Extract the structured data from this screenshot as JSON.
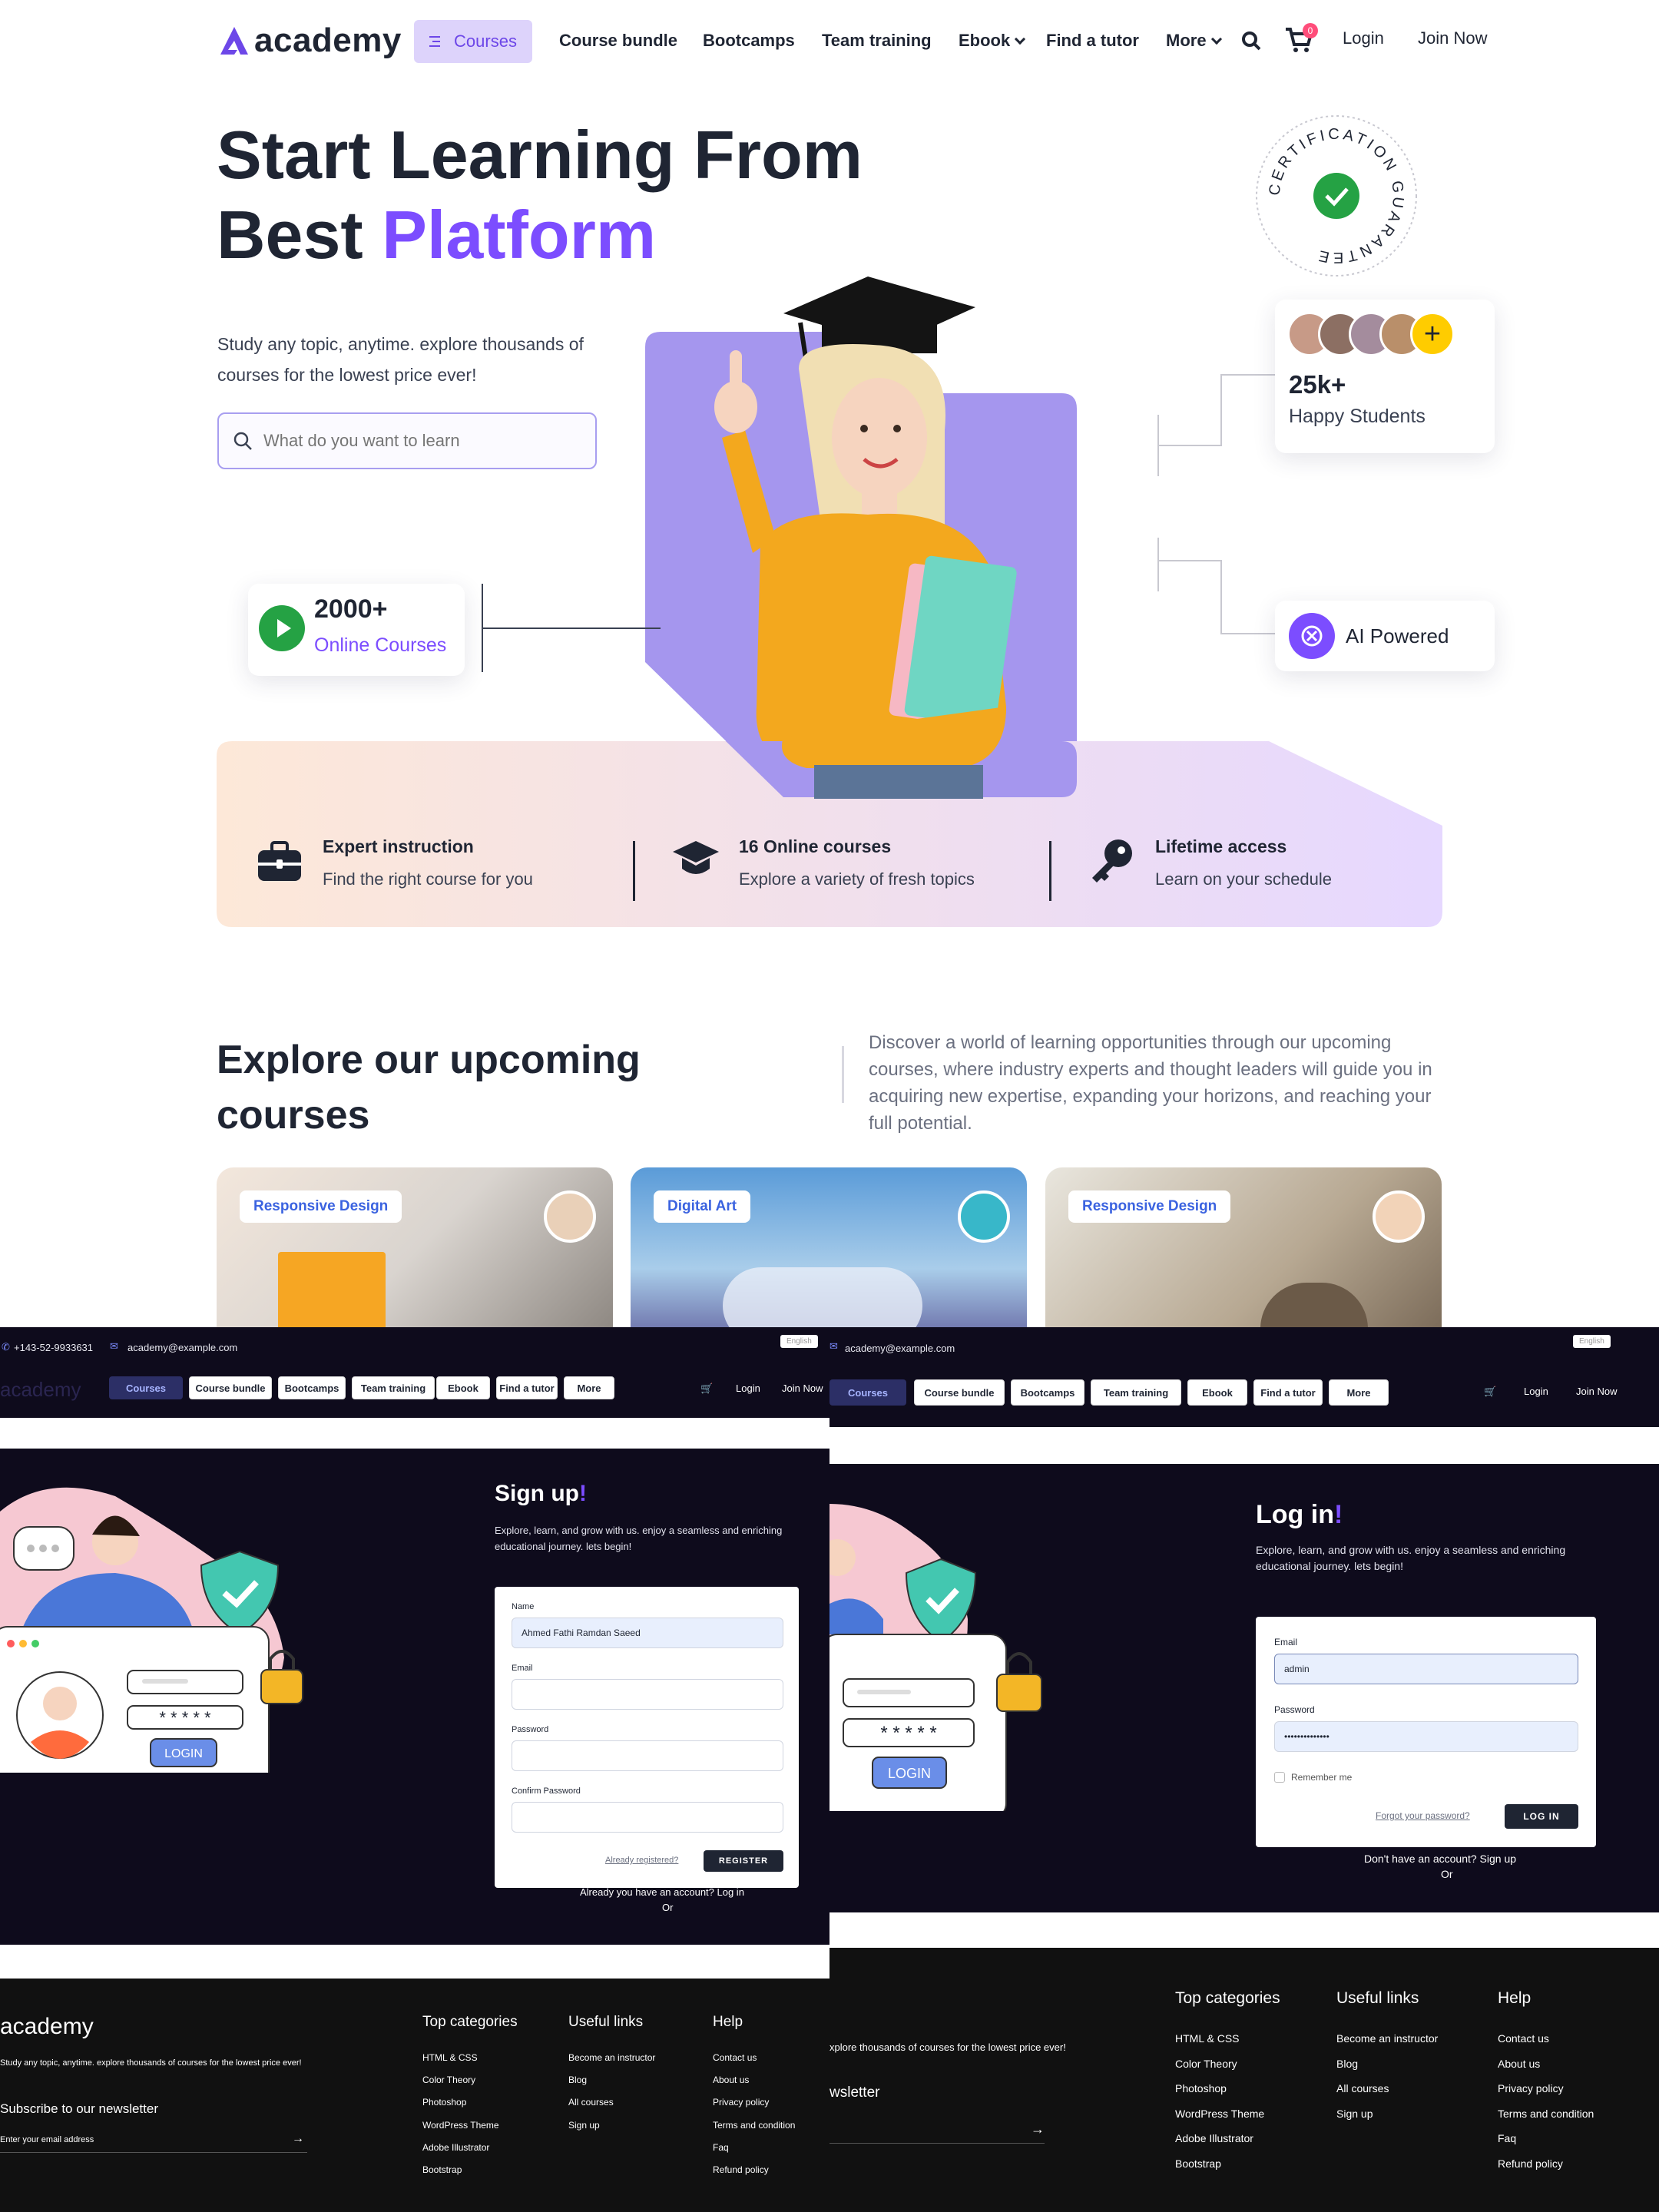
{
  "brand": {
    "name": "academy",
    "accent": "#7c4dff"
  },
  "nav": {
    "courses": "Courses",
    "course_bundle": "Course bundle",
    "bootcamps": "Bootcamps",
    "team_training": "Team training",
    "ebook": "Ebook",
    "find_tutor": "Find a tutor",
    "more": "More",
    "cart_count": "0",
    "login": "Login",
    "join_now": "Join Now"
  },
  "hero": {
    "title_line1": "Start Learning From",
    "title_line2_a": "Best ",
    "title_line2_b": "Platform",
    "desc": "Study any topic, anytime. explore thousands of courses for the lowest price ever!",
    "search_placeholder": "What do you want to learn",
    "certification_text": "CERTIFICATION GUARANTEE",
    "courses_stat_num": "2000+",
    "courses_stat_label": "Online Courses",
    "students_num": "25k+",
    "students_label": "Happy Students",
    "ai_label": "AI Powered"
  },
  "features": [
    {
      "title": "Expert instruction",
      "sub": "Find the right course for you"
    },
    {
      "title": "16 Online courses",
      "sub": "Explore a variety of fresh topics"
    },
    {
      "title": "Lifetime access",
      "sub": "Learn on your schedule"
    }
  ],
  "explore": {
    "title": "Explore our upcoming courses",
    "desc": "Discover a world of learning opportunities through our upcoming courses, where industry experts and thought leaders will guide you in acquiring new expertise, expanding your horizons, and reaching your full potential."
  },
  "course_cards": [
    {
      "tag": "Responsive Design"
    },
    {
      "tag": "Digital Art"
    },
    {
      "tag": "Responsive Design"
    }
  ],
  "topbar": {
    "phone": "+143-52-9933631",
    "email": "academy@example.com",
    "language": "English"
  },
  "signup": {
    "title": "Sign up",
    "exclaim": "!",
    "sub": "Explore, learn, and grow with us. enjoy a seamless and enriching educational journey. lets begin!",
    "name_label": "Name",
    "name_value": "Ahmed Fathi Ramdan Saeed",
    "email_label": "Email",
    "password_label": "Password",
    "confirm_label": "Confirm Password",
    "already_link": "Already registered?",
    "register_btn": "REGISTER",
    "have_account": "Already you have an account? Log in",
    "or": "Or"
  },
  "login": {
    "title": "Log in",
    "exclaim": "!",
    "sub": "Explore, learn, and grow with us. enjoy a seamless and enriching educational journey. lets begin!",
    "email_label": "Email",
    "email_value": "admin",
    "password_label": "Password",
    "password_value": "••••••••••••••",
    "remember": "Remember me",
    "forgot": "Forgot your password?",
    "login_btn": "LOG IN",
    "no_account": "Don't have an account? Sign up",
    "or": "Or"
  },
  "illustration": {
    "password_mask": "* * * * *",
    "login_button": "LOGIN"
  },
  "footer": {
    "desc_left": "Study any topic, anytime. explore thousands of courses for the lowest price ever!",
    "desc_right": "xplore thousands of courses for the lowest price ever!",
    "newsletter_left": "Subscribe to our newsletter",
    "newsletter_right": "wsletter",
    "email_placeholder": "Enter your email address",
    "col_categories": "Top categories",
    "col_useful": "Useful links",
    "col_help": "Help",
    "categories": [
      "HTML & CSS",
      "Color Theory",
      "Photoshop",
      "WordPress Theme",
      "Adobe Illustrator",
      "Bootstrap"
    ],
    "useful": [
      "Become an instructor",
      "Blog",
      "All courses",
      "Sign up"
    ],
    "help": [
      "Contact us",
      "About us",
      "Privacy policy",
      "Terms and condition",
      "Faq",
      "Refund policy"
    ]
  }
}
